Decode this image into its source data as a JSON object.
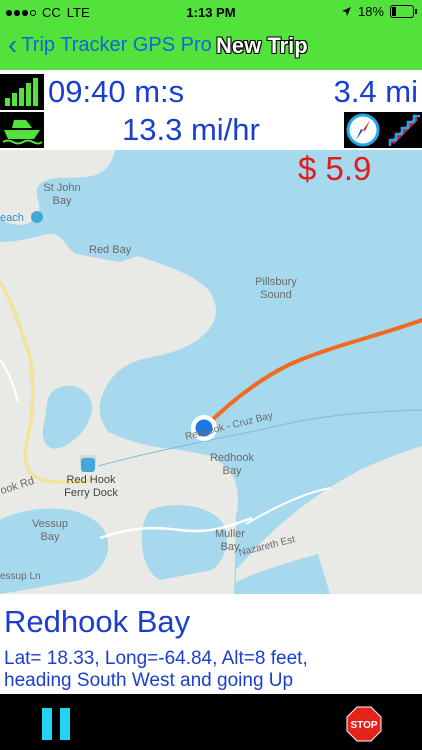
{
  "status": {
    "carrier": "CC",
    "network": "LTE",
    "time": "1:13 PM",
    "battery": "18%"
  },
  "nav": {
    "back_label": "Trip Tracker GPS Pro",
    "title": "New Trip"
  },
  "trip": {
    "elapsed": "09:40 m:s",
    "distance": "3.4 mi",
    "speed": "13.3 mi/hr",
    "cost": "$ 5.9"
  },
  "map": {
    "labels": {
      "st_john_bay": "St John\nBay",
      "beach": "each",
      "red_bay": "Red Bay",
      "pillsbury": "Pillsbury\nSound",
      "road_name": "Redhook - Cruz Bay",
      "redhook_bay": "Redhook\nBay",
      "ferry_dock": "Red Hook\nFerry Dock",
      "hook_rd": "ook Rd",
      "vessup_bay": "Vessup\nBay",
      "muller_bay": "Muller\nBay",
      "nazareth": "Nazareth Est",
      "vessup_ln": "essup Ln"
    }
  },
  "location": {
    "name": "Redhook Bay",
    "line1": "Lat= 18.33, Long=-64.84, Alt=8 feet,",
    "line2": "heading South West and going Up"
  },
  "icons": [
    "signal-icon",
    "boat-icon",
    "compass-icon",
    "stairs-icon",
    "pause-icon",
    "stop-icon",
    "location-arrow-icon",
    "battery-icon",
    "back-chevron-icon"
  ],
  "colors": {
    "bar_green": "#53e23c",
    "text_blue": "#1a3fd0",
    "price_red": "#e01c1c",
    "route_orange": "#f26a1b",
    "water": "#a6d8ee",
    "land": "#e9eae6"
  }
}
